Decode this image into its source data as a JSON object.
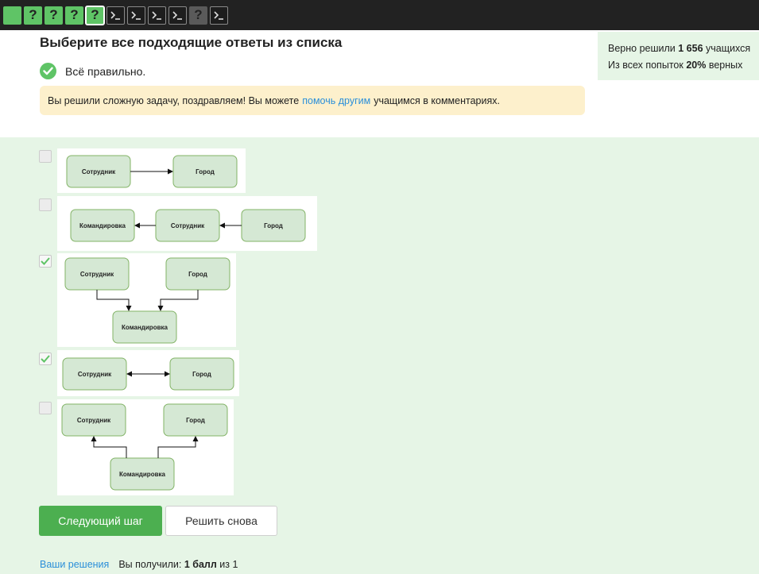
{
  "steps": [
    {
      "state": "solved",
      "label": ""
    },
    {
      "state": "solved",
      "label": "?"
    },
    {
      "state": "solved",
      "label": "?"
    },
    {
      "state": "solved",
      "label": "?"
    },
    {
      "state": "solved-current",
      "label": "?"
    },
    {
      "state": "code",
      "label": ""
    },
    {
      "state": "code",
      "label": ""
    },
    {
      "state": "code",
      "label": ""
    },
    {
      "state": "code",
      "label": ""
    },
    {
      "state": "pending",
      "label": "?"
    },
    {
      "state": "code",
      "label": ""
    }
  ],
  "header": {
    "title": "Выберите все подходящие ответы из списка",
    "correct_text": "Всё правильно.",
    "notice_before": "Вы решили сложную задачу, поздравляем! Вы можете",
    "notice_link": "помочь другим",
    "notice_after": "учащимся в комментариях."
  },
  "stats": {
    "line1_prefix": "Верно решили",
    "line1_value": "1 656",
    "line1_suffix": "учащихся",
    "line2_prefix": "Из всех попыток",
    "line2_value": "20%",
    "line2_suffix": "верных"
  },
  "options": [
    {
      "checked": false,
      "nodes": [
        "Сотрудник",
        "Город"
      ]
    },
    {
      "checked": false,
      "nodes": [
        "Командировка",
        "Сотрудник",
        "Город"
      ]
    },
    {
      "checked": true,
      "nodes": [
        "Сотрудник",
        "Город",
        "Командировка"
      ]
    },
    {
      "checked": true,
      "nodes": [
        "Сотрудник",
        "Город"
      ]
    },
    {
      "checked": false,
      "nodes": [
        "Сотрудник",
        "Город",
        "Командировка"
      ]
    }
  ],
  "buttons": {
    "next": "Следующий шаг",
    "retry": "Решить снова"
  },
  "footer": {
    "solutions_link": "Ваши решения",
    "score_prefix": "Вы получили:",
    "score_value": "1 балл",
    "score_mid": "из",
    "score_total": "1"
  },
  "colors": {
    "accent_green": "#4caf50",
    "node_fill": "#d5e8d4",
    "node_stroke": "#82b366",
    "link_blue": "#2b8fd9",
    "notice_bg": "#fdf0cc",
    "answer_bg": "#e6f5e6"
  }
}
